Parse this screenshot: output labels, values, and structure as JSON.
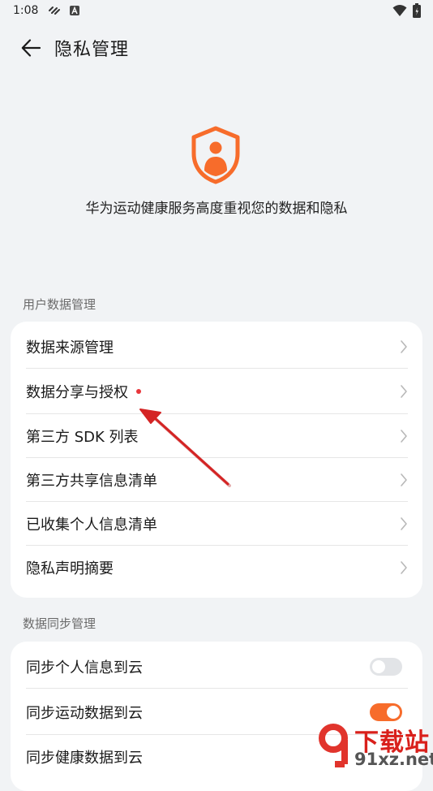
{
  "status_bar": {
    "time": "1:08"
  },
  "header": {
    "title": "隐私管理"
  },
  "hero": {
    "text": "华为运动健康服务高度重视您的数据和隐私"
  },
  "sections": [
    {
      "label": "用户数据管理",
      "items": [
        {
          "label": "数据来源管理"
        },
        {
          "label": "数据分享与授权",
          "badge": true
        },
        {
          "label": "第三方 SDK 列表"
        },
        {
          "label": "第三方共享信息清单"
        },
        {
          "label": "已收集个人信息清单"
        },
        {
          "label": "隐私声明摘要"
        }
      ]
    },
    {
      "label": "数据同步管理",
      "items": [
        {
          "label": "同步个人信息到云",
          "toggle": false
        },
        {
          "label": "同步运动数据到云",
          "toggle": true
        },
        {
          "label": "同步健康数据到云"
        }
      ]
    }
  ],
  "watermark": {
    "line1": "下载站",
    "line2": "91xz.net"
  },
  "colors": {
    "accent": "#f76c2b",
    "badge": "#e8363b",
    "annotation_arrow": "#d42424",
    "background": "#f1f3f5"
  }
}
